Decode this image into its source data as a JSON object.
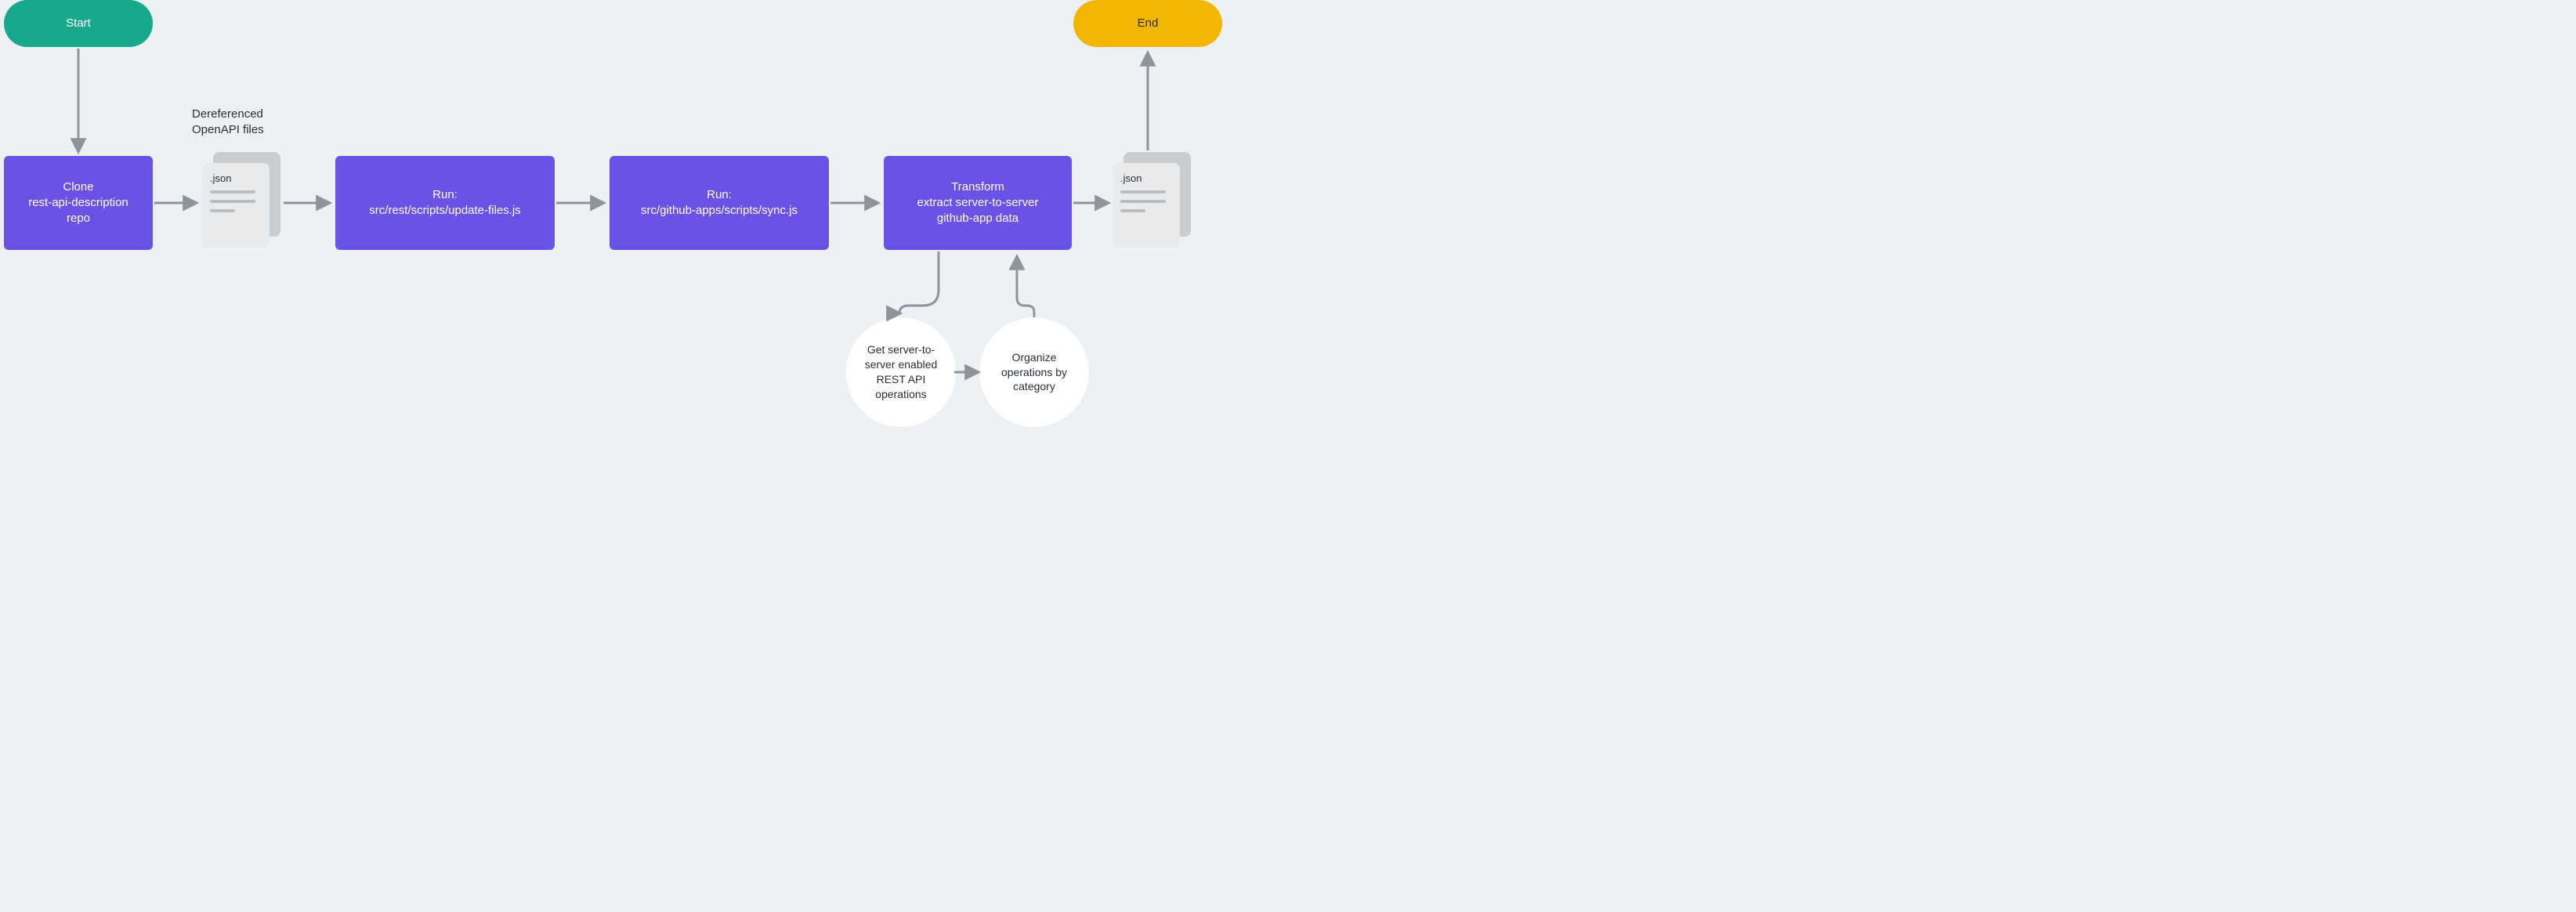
{
  "start": {
    "label": "Start"
  },
  "end": {
    "label": "End"
  },
  "clone": {
    "line1": "Clone",
    "line2": "rest-api-description",
    "line3": "repo"
  },
  "deref_caption": {
    "l1": "Dereferenced",
    "l2": "OpenAPI files"
  },
  "file1": {
    "ext": ".json"
  },
  "run1": {
    "line1": "Run:",
    "line2": "src/rest/scripts/update-files.js"
  },
  "run2": {
    "line1": "Run:",
    "line2": "src/github-apps/scripts/sync.js"
  },
  "transform": {
    "line1": "Transform",
    "line2": "extract server-to-server",
    "line3": "github-app data"
  },
  "file2": {
    "ext": ".json"
  },
  "circle1": {
    "l1": "Get server-to-",
    "l2": "server enabled",
    "l3": "REST API",
    "l4": "operations"
  },
  "circle2": {
    "l1": "Organize",
    "l2": "operations by",
    "l3": "category"
  },
  "colors": {
    "start": "#18a98c",
    "end": "#f2b705",
    "proc": "#6a52e6",
    "arrow": "#8c949c",
    "bg": "#eef1f4"
  }
}
